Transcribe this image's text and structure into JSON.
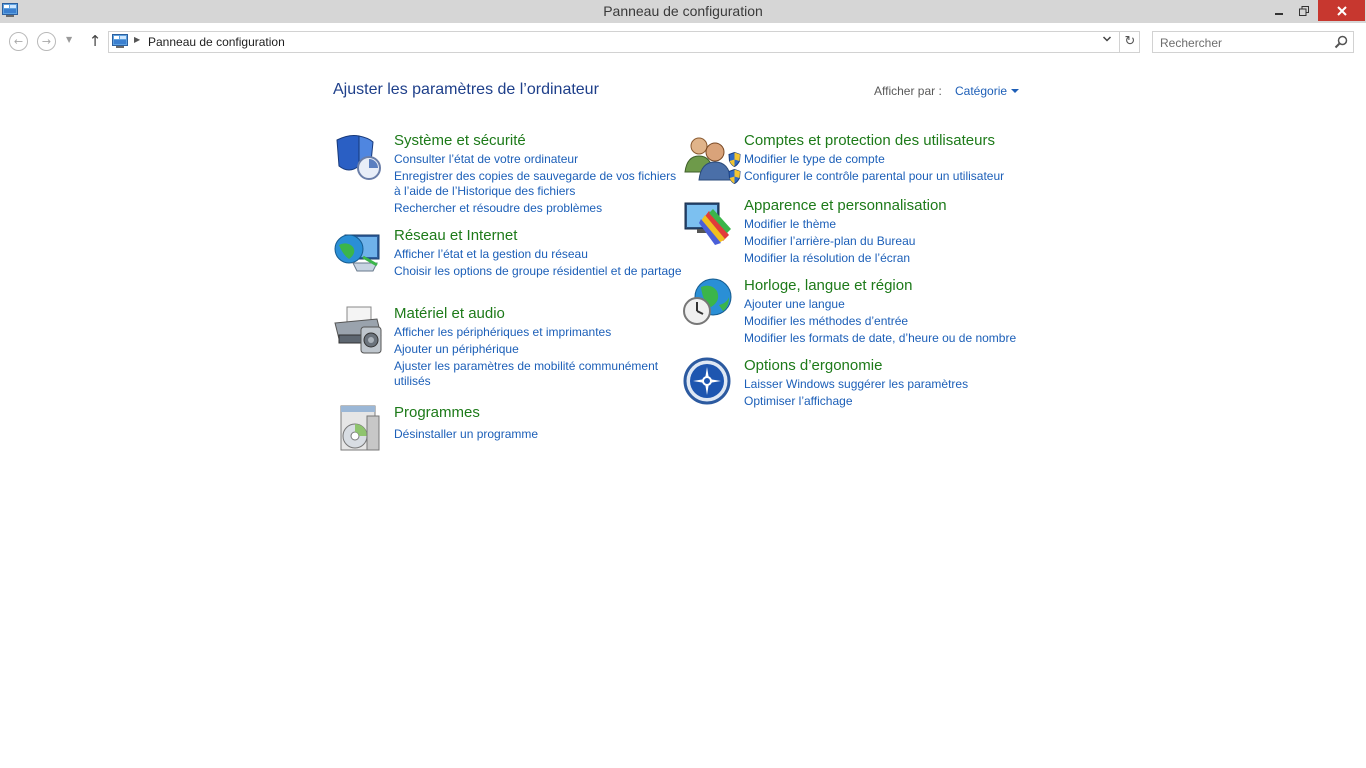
{
  "window": {
    "title": "Panneau de configuration"
  },
  "address_bar": {
    "breadcrumb": "Panneau de configuration"
  },
  "search": {
    "placeholder": "Rechercher"
  },
  "content": {
    "title": "Ajuster les paramètres de l’ordinateur",
    "view_by_label": "Afficher par :",
    "view_by_value": "Catégorie"
  },
  "categories": {
    "system": {
      "title": "Système et sécurité",
      "links": [
        "Consulter l’état de votre ordinateur",
        "Enregistrer des copies de sauvegarde de vos fichiers à l’aide de l’Historique des fichiers",
        "Rechercher et résoudre des problèmes"
      ]
    },
    "network": {
      "title": "Réseau et Internet",
      "links": [
        "Afficher l’état et la gestion du réseau",
        "Choisir les options de groupe résidentiel et de partage"
      ]
    },
    "hardware": {
      "title": "Matériel et audio",
      "links": [
        "Afficher les périphériques et imprimantes",
        "Ajouter un périphérique",
        "Ajuster les paramètres de mobilité communément utilisés"
      ]
    },
    "programs": {
      "title": "Programmes",
      "links": [
        "Désinstaller un programme"
      ]
    },
    "accounts": {
      "title": "Comptes et protection des utilisateurs",
      "links": [
        "Modifier le type de compte",
        "Configurer le contrôle parental pour un utilisateur"
      ]
    },
    "appearance": {
      "title": "Apparence et personnalisation",
      "links": [
        "Modifier le thème",
        "Modifier l’arrière-plan du Bureau",
        "Modifier la résolution de l’écran"
      ]
    },
    "clock": {
      "title": "Horloge, langue et région",
      "links": [
        "Ajouter une langue",
        "Modifier les méthodes d’entrée",
        "Modifier les formats de date, d’heure ou de nombre"
      ]
    },
    "ease": {
      "title": "Options d’ergonomie",
      "links": [
        "Laisser Windows suggérer les paramètres",
        "Optimiser l’affichage"
      ]
    }
  },
  "colors": {
    "link": "#1c5fb8",
    "category_title": "#1d7a19",
    "page_title": "#1e3f8a",
    "close_button": "#c7372f",
    "titlebar": "#d6d6d6"
  }
}
